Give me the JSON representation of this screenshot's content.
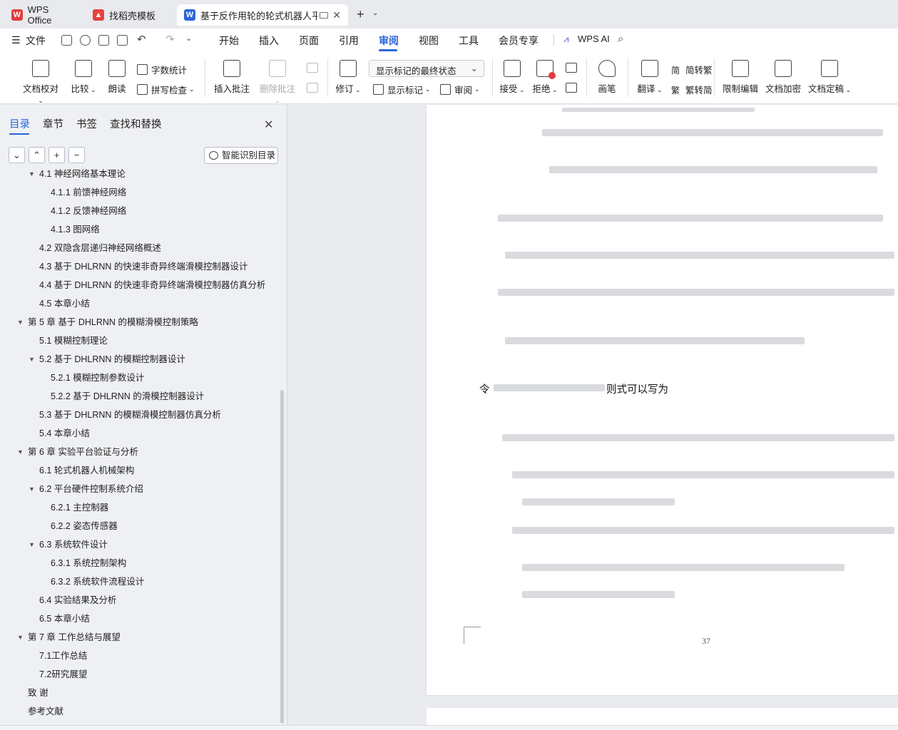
{
  "tabs": [
    {
      "label": "WPS Office",
      "icon": "wps-logo-icon"
    },
    {
      "label": "找稻壳模板",
      "icon": "docer-logo-icon"
    },
    {
      "label": "基于反作用轮的轮式机器人平衡",
      "icon": "word-doc-icon"
    }
  ],
  "menubar": {
    "file": "文件",
    "items": [
      "开始",
      "插入",
      "页面",
      "引用",
      "审阅",
      "视图",
      "工具",
      "会员专享"
    ],
    "active": "审阅",
    "wps_ai": "WPS AI"
  },
  "ribbon": {
    "doc_proof": "文档校对",
    "compare": "比较",
    "read_aloud": "朗读",
    "word_count": "字数统计",
    "spell_check": "拼写检查",
    "insert_comment": "插入批注",
    "delete_comment": "删除批注",
    "revise": "修订",
    "markup_state": "显示标记的最终状态",
    "show_markup": "显示标记",
    "review": "审阅",
    "accept": "接受",
    "reject": "拒绝",
    "pen": "画笔",
    "translate": "翻译",
    "to_traditional": "简转繁",
    "to_simplified": "繁转简",
    "restrict_edit": "限制编辑",
    "doc_encrypt": "文档加密",
    "doc_finalize": "文档定稿"
  },
  "nav": {
    "tabs": [
      "目录",
      "章节",
      "书签",
      "查找和替换"
    ],
    "smart_toc": "智能识别目录",
    "items": [
      {
        "label": "4.1 神经网络基本理论",
        "level": 2,
        "arrow": true
      },
      {
        "label": "4.1.1 前馈神经网络",
        "level": 3
      },
      {
        "label": "4.1.2 反馈神经网络",
        "level": 3
      },
      {
        "label": "4.1.3 图网络",
        "level": 3
      },
      {
        "label": "4.2 双隐含层递归神经网络概述",
        "level": 2
      },
      {
        "label": "4.3 基于 DHLRNN 的快速非奇异终端滑模控制器设计",
        "level": 2
      },
      {
        "label": "4.4 基于 DHLRNN 的快速非奇异终端滑模控制器仿真分析",
        "level": 2
      },
      {
        "label": "4.5 本章小结",
        "level": 2
      },
      {
        "label": "第 5 章  基于 DHLRNN 的模糊滑模控制策略",
        "level": 1,
        "arrow": true
      },
      {
        "label": "5.1 模糊控制理论",
        "level": 2
      },
      {
        "label": "5.2 基于 DHLRNN 的模糊控制器设计",
        "level": 2,
        "arrow": true
      },
      {
        "label": "5.2.1 模糊控制参数设计",
        "level": 3
      },
      {
        "label": "5.2.2 基于 DHLRNN 的滑模控制器设计",
        "level": 3
      },
      {
        "label": "5.3 基于 DHLRNN 的模糊滑模控制器仿真分析",
        "level": 2
      },
      {
        "label": "5.4 本章小结",
        "level": 2
      },
      {
        "label": "第 6 章  实验平台验证与分析",
        "level": 1,
        "arrow": true
      },
      {
        "label": "6.1 轮式机器人机械架构",
        "level": 2
      },
      {
        "label": "6.2 平台硬件控制系统介绍",
        "level": 2,
        "arrow": true
      },
      {
        "label": "6.2.1 主控制器",
        "level": 3
      },
      {
        "label": "6.2.2 姿态传感器",
        "level": 3
      },
      {
        "label": "6.3 系统软件设计",
        "level": 2,
        "arrow": true
      },
      {
        "label": "6.3.1 系统控制架构",
        "level": 3
      },
      {
        "label": "6.3.2 系统软件流程设计",
        "level": 3
      },
      {
        "label": "6.4 实验结果及分析",
        "level": 2
      },
      {
        "label": "6.5 本章小结",
        "level": 2
      },
      {
        "label": "第 7 章  工作总结与展望",
        "level": 1,
        "arrow": true
      },
      {
        "label": "7.1工作总结",
        "level": 2
      },
      {
        "label": "7.2研究展望",
        "level": 2
      },
      {
        "label": "致    谢",
        "level": 1
      },
      {
        "label": "参考文献",
        "level": 1
      }
    ]
  },
  "document": {
    "intro_text": "令",
    "condition_text": "则式可以写为",
    "page_number": "37"
  }
}
